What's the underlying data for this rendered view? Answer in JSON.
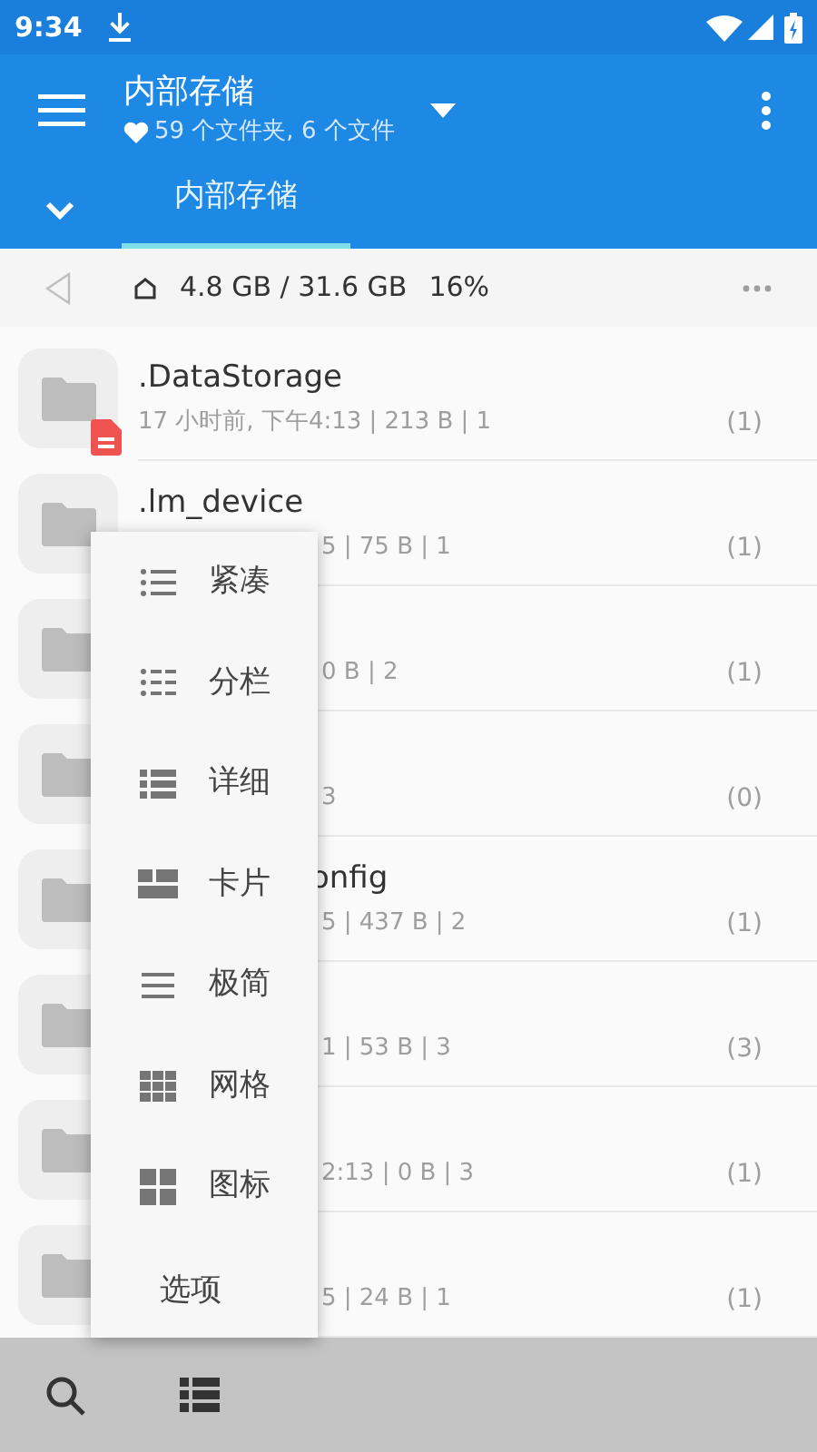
{
  "status_bar": {
    "time": "9:34"
  },
  "app_bar": {
    "title": "内部存储",
    "subtitle": "59 个文件夹, 6 个文件"
  },
  "tabs": [
    {
      "label": "内部存储",
      "selected": true
    }
  ],
  "path_bar": {
    "usage": "4.8 GB / 31.6 GB",
    "percent": "16%"
  },
  "rows": [
    {
      "name": ".DataStorage",
      "meta": "17 小时前, 下午4:13 | 213 B | 1",
      "count": "(1)",
      "badge": true,
      "name_covered": false,
      "meta_covered": false
    },
    {
      "name": ".lm_device",
      "meta": "5 | 75 B | 1",
      "count": "(1)",
      "name_covered": false,
      "meta_covered": true
    },
    {
      "meta": "0 B | 2",
      "count": "(1)",
      "meta_covered": true
    },
    {
      "meta": "3",
      "count": "(0)",
      "meta_covered": true
    },
    {
      "name": "onfig",
      "meta": "5 | 437 B | 2",
      "count": "(1)",
      "name_covered": true,
      "meta_covered": true
    },
    {
      "meta": "1 | 53 B | 3",
      "count": "(3)",
      "meta_covered": true
    },
    {
      "meta": "2:13 | 0 B | 3",
      "count": "(1)",
      "meta_covered": true
    },
    {
      "meta": "5 | 24 B | 1",
      "count": "(1)",
      "meta_covered": true
    }
  ],
  "menu": [
    {
      "kind": "compact",
      "label": "紧凑"
    },
    {
      "kind": "columns",
      "label": "分栏"
    },
    {
      "kind": "detail",
      "label": "详细"
    },
    {
      "kind": "card",
      "label": "卡片"
    },
    {
      "kind": "minimal",
      "label": "极简"
    },
    {
      "kind": "grid",
      "label": "网格"
    },
    {
      "kind": "icons",
      "label": "图标"
    },
    {
      "kind": "options",
      "label": "选项"
    }
  ]
}
